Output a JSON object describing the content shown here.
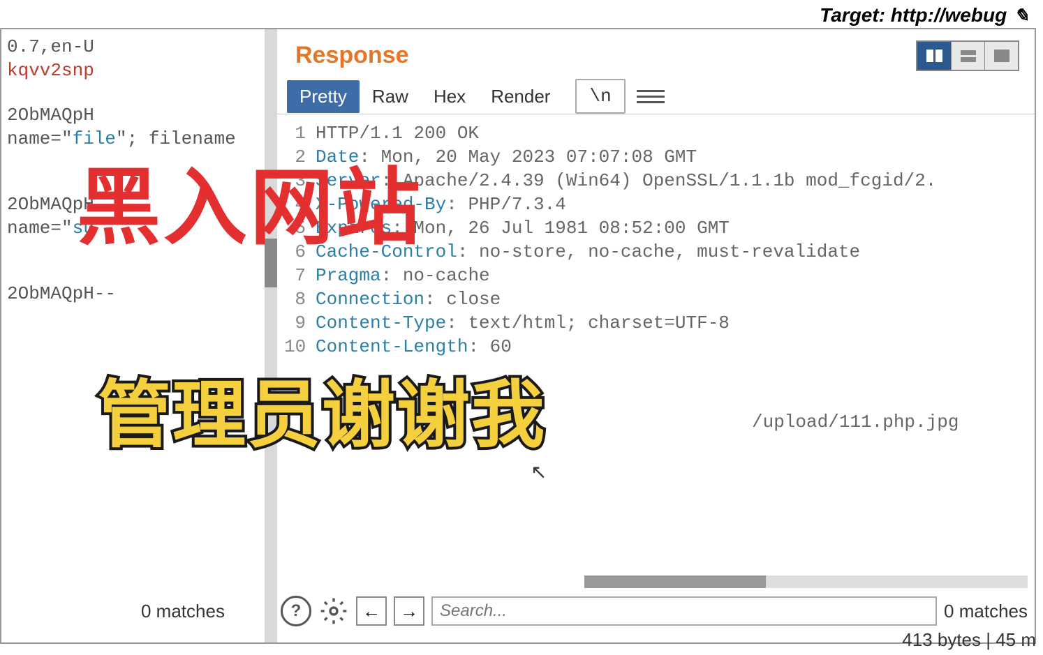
{
  "top": {
    "target": "Target: http://webug",
    "pencil_icon": "pencil-icon"
  },
  "overlays": {
    "red": "黑入网站",
    "yellow": "管理员谢谢我"
  },
  "left": {
    "line1_a": "0.7,en-U",
    "line1_b": "kqvv2snp",
    "line2_a": "2ObMAQpH",
    "line2_b_pre": "name=\"",
    "line2_b_attr": "file",
    "line2_b_post": "\"; filename",
    "line3_a": "2ObMAQpH",
    "line3_b_pre": "name=\"",
    "line3_b_attr": "su",
    "line4": "2ObMAQpH--",
    "matches": "0 matches"
  },
  "response": {
    "title": "Response",
    "tabs": {
      "pretty": "Pretty",
      "raw": "Raw",
      "hex": "Hex",
      "render": "Render",
      "newline": "\\n"
    },
    "lines": [
      {
        "n": "1",
        "kw": "",
        "rest": "HTTP/1.1 200 OK"
      },
      {
        "n": "2",
        "kw": "Date",
        "rest": ": Mon, 20 May 2023 07:07:08 GMT"
      },
      {
        "n": "3",
        "kw": "Server",
        "rest": ": Apache/2.4.39 (Win64) OpenSSL/1.1.1b mod_fcgid/2."
      },
      {
        "n": "4",
        "kw": "X-Powered-By",
        "rest": ": PHP/7.3.4"
      },
      {
        "n": "5",
        "kw": "Expires",
        "rest": ": Mon, 26 Jul 1981 08:52:00 GMT"
      },
      {
        "n": "6",
        "kw": "Cache-Control",
        "rest": ": no-store, no-cache, must-revalidate"
      },
      {
        "n": "7",
        "kw": "Pragma",
        "rest": ": no-cache"
      },
      {
        "n": "8",
        "kw": "Connection",
        "rest": ": close"
      },
      {
        "n": "9",
        "kw": "Content-Type",
        "rest": ": text/html; charset=UTF-8"
      },
      {
        "n": "10",
        "kw": "Content-Length",
        "rest": ": 60"
      }
    ],
    "body_path": "/upload/111.php.jpg",
    "search_placeholder": "Search...",
    "matches": "0 matches"
  },
  "status": "413 bytes | 45 m"
}
